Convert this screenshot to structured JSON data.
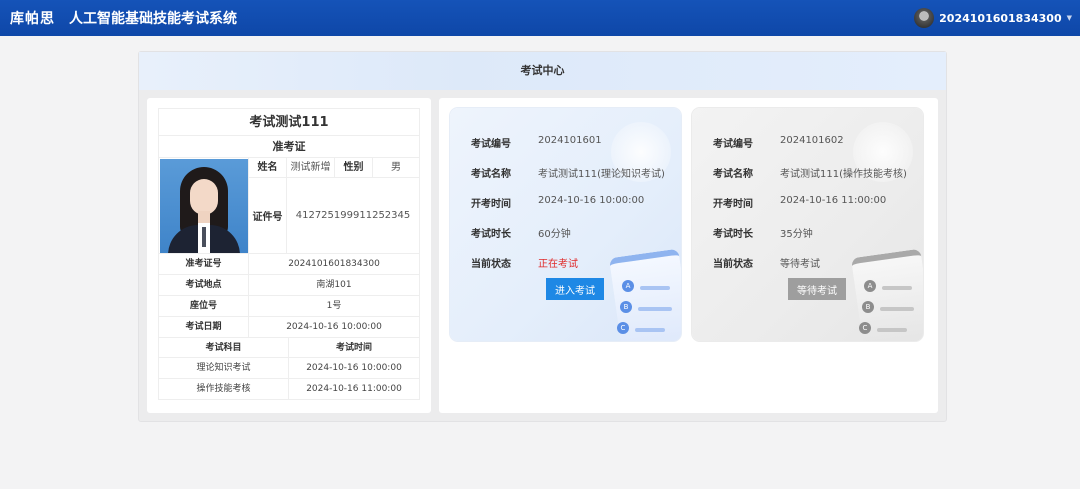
{
  "header": {
    "brand": "库帕思",
    "title": "人工智能基础技能考试系统",
    "username": "2024101601834300"
  },
  "frame": {
    "title": "考试中心"
  },
  "ticket": {
    "exam_name": "考试测试111",
    "card_title": "准考证",
    "name_label": "姓名",
    "name_value": "测试新增",
    "gender_label": "性别",
    "gender_value": "男",
    "id_label": "证件号",
    "id_value": "412725199911252345",
    "rows": [
      {
        "label": "准考证号",
        "value": "2024101601834300"
      },
      {
        "label": "考试地点",
        "value": "南湖101"
      },
      {
        "label": "座位号",
        "value": "1号"
      },
      {
        "label": "考试日期",
        "value": "2024-10-16 10:00:00"
      }
    ],
    "subjects_header": {
      "subject": "考试科目",
      "time": "考试时间"
    },
    "subjects": [
      {
        "subject": "理论知识考试",
        "time": "2024-10-16 10:00:00"
      },
      {
        "subject": "操作技能考核",
        "time": "2024-10-16 11:00:00"
      }
    ]
  },
  "cards": [
    {
      "labels": [
        "考试编号",
        "考试名称",
        "开考时间",
        "考试时长",
        "当前状态"
      ],
      "number": "2024101601",
      "name": "考试测试111(理论知识考试)",
      "start": "2024-10-16 10:00:00",
      "duration": "60分钟",
      "status": "正在考试",
      "button": "进入考试"
    },
    {
      "labels": [
        "考试编号",
        "考试名称",
        "开考时间",
        "考试时长",
        "当前状态"
      ],
      "number": "2024101602",
      "name": "考试测试111(操作技能考核)",
      "start": "2024-10-16 11:00:00",
      "duration": "35分钟",
      "status": "等待考试",
      "button": "等待考试"
    }
  ],
  "deco_options": [
    "A",
    "B",
    "C"
  ],
  "colors": {
    "topbar": "#0e47a8",
    "status_active": "#e02a2a",
    "enter_button": "#1e88e5",
    "wait_button": "#9e9e9e"
  }
}
